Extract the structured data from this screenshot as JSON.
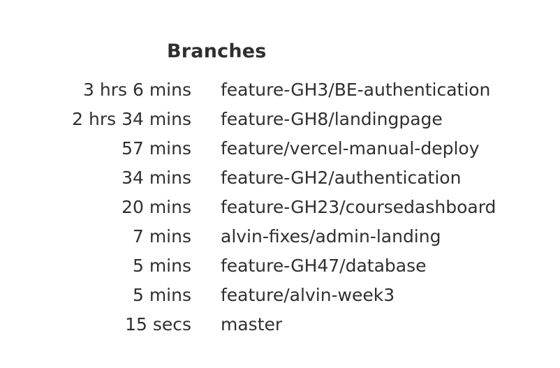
{
  "title": "Branches",
  "branches": [
    {
      "duration": "3 hrs 6 mins",
      "name": "feature-GH3/BE-authentication"
    },
    {
      "duration": "2 hrs 34 mins",
      "name": "feature-GH8/landingpage"
    },
    {
      "duration": "57 mins",
      "name": "feature/vercel-manual-deploy"
    },
    {
      "duration": "34 mins",
      "name": "feature-GH2/authentication"
    },
    {
      "duration": "20 mins",
      "name": "feature-GH23/coursedashboard"
    },
    {
      "duration": "7 mins",
      "name": "alvin-fixes/admin-landing"
    },
    {
      "duration": "5 mins",
      "name": "feature-GH47/database"
    },
    {
      "duration": "5 mins",
      "name": "feature/alvin-week3"
    },
    {
      "duration": "15 secs",
      "name": "master"
    }
  ]
}
